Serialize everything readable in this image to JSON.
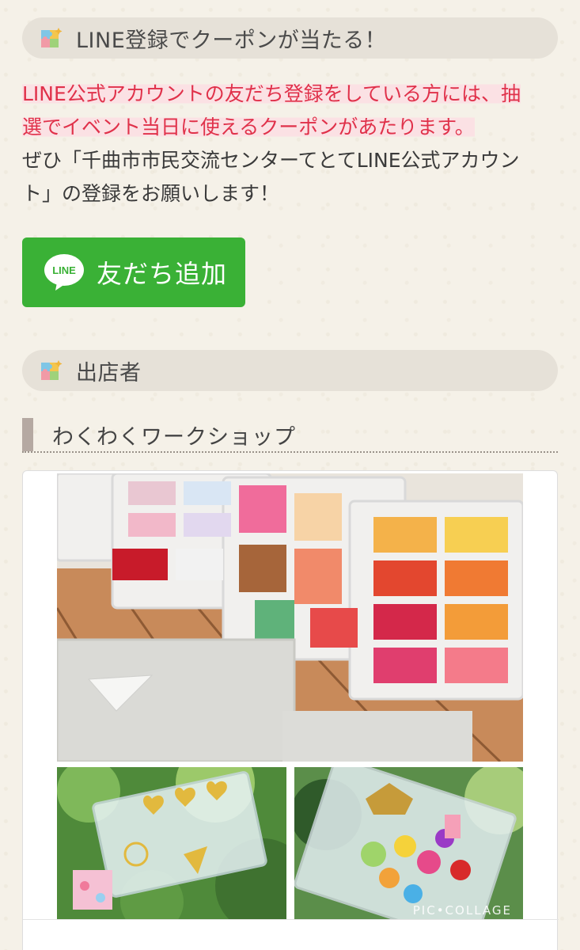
{
  "coupon_section": {
    "title": "LINE登録でクーポンが当たる！",
    "highlight_line1": "LINE公式アカウントの友だち登録をしている方には、抽",
    "highlight_line2": "選でイベント当日に使えるクーポンがあたります。",
    "body_line1": "ぜひ「千曲市市民交流センターてとてLINE公式アカウン",
    "body_line2": "ト」の登録をお願いします！"
  },
  "line_button": {
    "badge": "LINE",
    "label": "友だち追加",
    "color": "#3ab136"
  },
  "exhibitor_section": {
    "title": "出店者"
  },
  "workshop": {
    "title": "わくわくワークショップ",
    "photo_watermark": "PIC•COLLAGE"
  },
  "colors": {
    "highlight_text": "#e0314a",
    "highlight_bg": "#fbe1e4",
    "header_bg": "#e6e1d8"
  }
}
